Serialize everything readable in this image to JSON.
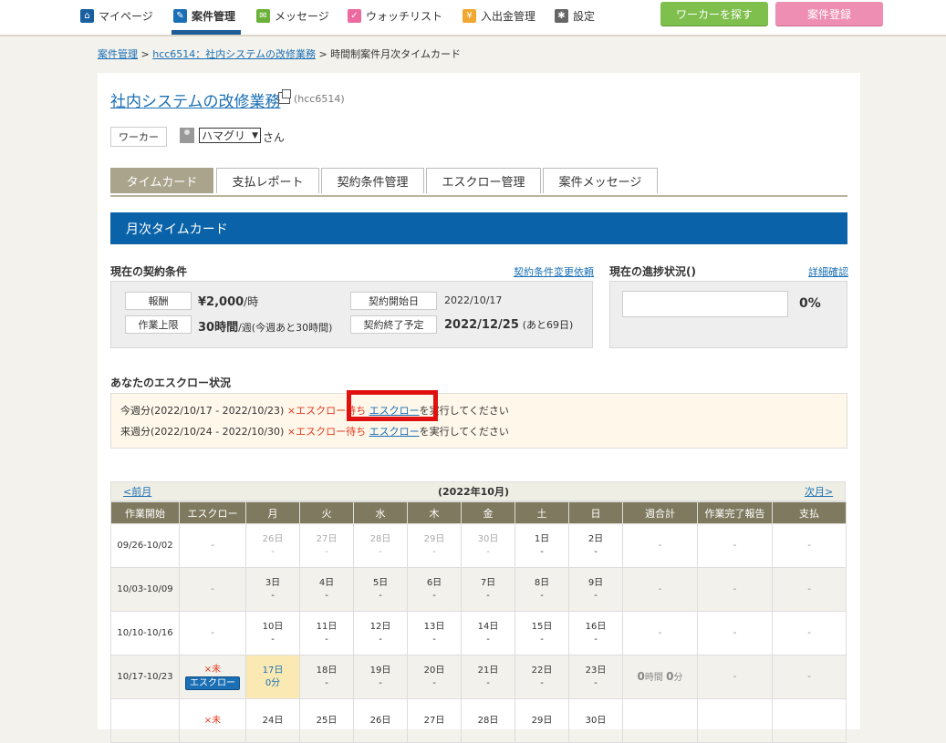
{
  "nav": {
    "items": [
      {
        "label": "マイページ",
        "icon": "home-icon"
      },
      {
        "label": "案件管理",
        "icon": "pencil-icon"
      },
      {
        "label": "メッセージ",
        "icon": "mail-icon"
      },
      {
        "label": "ウォッチリスト",
        "icon": "check-icon"
      },
      {
        "label": "入出金管理",
        "icon": "yen-icon"
      },
      {
        "label": "設定",
        "icon": "gear-icon"
      }
    ],
    "find_worker": "ワーカーを探す",
    "register": "案件登録"
  },
  "breadcrumb": {
    "item1": "案件管理",
    "sep": ">",
    "item2": "hcc6514：社内システムの改修業務",
    "item3": "時間制案件月次タイムカード"
  },
  "project": {
    "title": "社内システムの改修業務",
    "code": "(hcc6514)"
  },
  "worker": {
    "label": "ワーカー",
    "name": "ハマグリ",
    "suffix": "さん"
  },
  "tabs": [
    "タイムカード",
    "支払レポート",
    "契約条件管理",
    "エスクロー管理",
    "案件メッセージ"
  ],
  "section_title": "月次タイムカード",
  "contract": {
    "title": "現在の契約条件",
    "change_link": "契約条件変更依頼",
    "reward_label": "報酬",
    "reward_value": "¥2,000",
    "reward_unit": "/時",
    "limit_label": "作業上限",
    "limit_value": "30時間",
    "limit_note": "/週(今週あと30時間)",
    "start_label": "契約開始日",
    "start_value": "2022/10/17",
    "end_label": "契約終了予定",
    "end_value": "2022/12/25",
    "end_note": "(あと69日)"
  },
  "progress": {
    "title": "現在の進捗状況()",
    "detail_link": "詳細確認",
    "percent": "0%"
  },
  "escrow": {
    "title": "あなたのエスクロー状況",
    "row1_period": "今週分(2022/10/17 - 2022/10/23)",
    "row1_status": "×エスクロー待ち",
    "row2_period": "来週分(2022/10/24 - 2022/10/30)",
    "row2_status": "×エスクロー待ち",
    "link": "エスクロー",
    "suffix": "を実行してください"
  },
  "calendar": {
    "prev": "<前月",
    "next": "次月>",
    "month": "(2022年10月)",
    "headers": [
      "作業開始",
      "エスクロー",
      "月",
      "火",
      "水",
      "木",
      "金",
      "土",
      "日",
      "週合計",
      "作業完了報告",
      "支払"
    ],
    "rows": [
      {
        "week": "09/26-10/02",
        "escrow": "-",
        "days": [
          "26日",
          "27日",
          "28日",
          "29日",
          "30日",
          "1日",
          "2日"
        ],
        "vals": [
          "-",
          "-",
          "-",
          "-",
          "-",
          "-",
          "-"
        ],
        "total": "-",
        "report": "-",
        "pay": "-"
      },
      {
        "week": "10/03-10/09",
        "escrow": "-",
        "days": [
          "3日",
          "4日",
          "5日",
          "6日",
          "7日",
          "8日",
          "9日"
        ],
        "vals": [
          "-",
          "-",
          "-",
          "-",
          "-",
          "-",
          "-"
        ],
        "total": "-",
        "report": "-",
        "pay": "-"
      },
      {
        "week": "10/10-10/16",
        "escrow": "-",
        "days": [
          "10日",
          "11日",
          "12日",
          "13日",
          "14日",
          "15日",
          "16日"
        ],
        "vals": [
          "-",
          "-",
          "-",
          "-",
          "-",
          "-",
          "-"
        ],
        "total": "-",
        "report": "-",
        "pay": "-"
      },
      {
        "week": "10/17-10/23",
        "escrow_status": "×未",
        "escrow_btn": "エスクロー",
        "days": [
          "17日",
          "18日",
          "19日",
          "20日",
          "21日",
          "22日",
          "23日"
        ],
        "vals": [
          "0分",
          "-",
          "-",
          "-",
          "-",
          "-",
          "-"
        ],
        "total_h": "0",
        "total_h_unit": "時間",
        "total_m": "0",
        "total_m_unit": "分",
        "report": "-",
        "pay": "-"
      },
      {
        "week": "",
        "escrow_status": "×未",
        "days": [
          "24日",
          "25日",
          "26日",
          "27日",
          "28日",
          "29日",
          "30日"
        ],
        "vals": [
          "",
          "",
          "",
          "",
          "",
          "",
          ""
        ]
      }
    ]
  }
}
